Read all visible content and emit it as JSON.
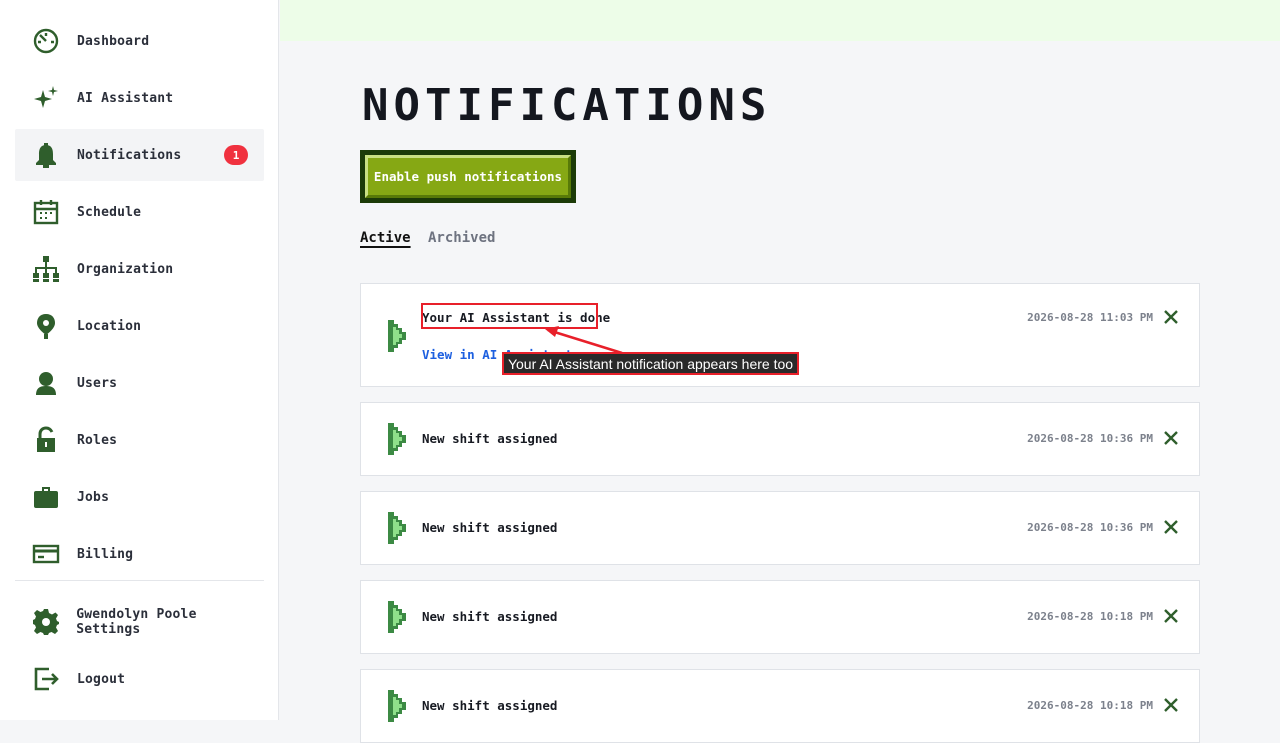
{
  "sidebar": {
    "items": [
      {
        "label": "Dashboard",
        "icon": "dashboard-icon"
      },
      {
        "label": "AI Assistant",
        "icon": "sparkle-icon"
      },
      {
        "label": "Notifications",
        "icon": "bell-icon",
        "badge": "1",
        "active": true
      },
      {
        "label": "Schedule",
        "icon": "calendar-icon"
      },
      {
        "label": "Organization",
        "icon": "org-chart-icon"
      },
      {
        "label": "Location",
        "icon": "location-pin-icon"
      },
      {
        "label": "Users",
        "icon": "user-icon"
      },
      {
        "label": "Roles",
        "icon": "padlock-icon"
      },
      {
        "label": "Jobs",
        "icon": "briefcase-icon"
      },
      {
        "label": "Billing",
        "icon": "credit-card-icon"
      }
    ],
    "settings_label": "Gwendolyn Poole Settings",
    "logout_label": "Logout"
  },
  "colors": {
    "accent": "#2f5e2c",
    "button": "#86a814",
    "badge": "#f0313f",
    "link": "#1c5fe0",
    "topbar": "#edfde8"
  },
  "page": {
    "title": "NOTIFICATIONS",
    "push_button": "Enable push notifications",
    "tabs": [
      {
        "label": "Active",
        "active": true
      },
      {
        "label": "Archived",
        "active": false
      }
    ]
  },
  "notifications": [
    {
      "title": "Your AI Assistant is done",
      "time": "2026-08-28 11:03 PM",
      "link": "View in AI Assistant"
    },
    {
      "title": "New shift assigned",
      "time": "2026-08-28 10:36 PM"
    },
    {
      "title": "New shift assigned",
      "time": "2026-08-28 10:36 PM"
    },
    {
      "title": "New shift assigned",
      "time": "2026-08-28 10:18 PM"
    },
    {
      "title": "New shift assigned",
      "time": "2026-08-28 10:18 PM"
    }
  ],
  "annotation": {
    "callout": "Your AI Assistant notification appears here too"
  }
}
